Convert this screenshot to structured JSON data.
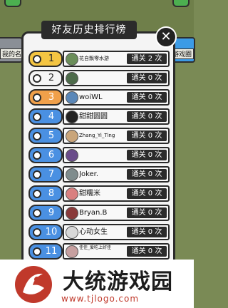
{
  "title": "好友历史排行榜",
  "close_label": "✕",
  "background": {
    "left_label": "我的名片",
    "right_label": "游戏圈"
  },
  "rows": [
    {
      "rank": "1",
      "name": "花自飘零水游",
      "score": "通关 2 次",
      "style": "rank-1",
      "avatar_color": "#6b8e5a",
      "name_size": "small"
    },
    {
      "rank": "2",
      "name": "",
      "score": "通关 0 次",
      "style": "rank-2",
      "avatar_color": "#4d6b4a",
      "name_size": "normal"
    },
    {
      "rank": "3",
      "name": "woiWL",
      "score": "通关 0 次",
      "style": "rank-3",
      "avatar_color": "#5a87b8",
      "name_size": "normal"
    },
    {
      "rank": "4",
      "name": "甜甜圆圆",
      "score": "通关 0 次",
      "style": "rank-blue",
      "avatar_color": "#222222",
      "name_size": "normal"
    },
    {
      "rank": "5",
      "name": "Zhang_Yi_Ting",
      "score": "通关 0 次",
      "style": "rank-blue",
      "avatar_color": "#c9a57a",
      "name_size": "small"
    },
    {
      "rank": "6",
      "name": "",
      "score": "通关 0 次",
      "style": "rank-blue",
      "avatar_color": "#6a4c8a",
      "name_size": "normal"
    },
    {
      "rank": "7",
      "name": "Joker.",
      "score": "通关 0 次",
      "style": "rank-blue",
      "avatar_color": "#7f8c8d",
      "name_size": "normal"
    },
    {
      "rank": "8",
      "name": "甜糯米",
      "score": "通关 0 次",
      "style": "rank-blue",
      "avatar_color": "#d98080",
      "name_size": "normal"
    },
    {
      "rank": "9",
      "name": "Bryan.B",
      "score": "通关 0 次",
      "style": "rank-blue",
      "avatar_color": "#8a3a3a",
      "name_size": "normal"
    },
    {
      "rank": "10",
      "name": "心动女生",
      "score": "通关 0 次",
      "style": "rank-blue",
      "avatar_color": "#d8d8d8",
      "name_size": "normal"
    },
    {
      "rank": "11",
      "name": "佳佳_爱吃上好佳",
      "score": "通关 0 次",
      "style": "rank-blue",
      "avatar_color": "#c7a0a0",
      "name_size": "tiny"
    }
  ],
  "watermark": {
    "text": "大统游戏园",
    "url": "www.tjlogo.com"
  },
  "colors": {
    "gold": "#f4c542",
    "orange": "#f0a04a",
    "blue": "#4a90e2",
    "dark": "#2b2b2b"
  }
}
